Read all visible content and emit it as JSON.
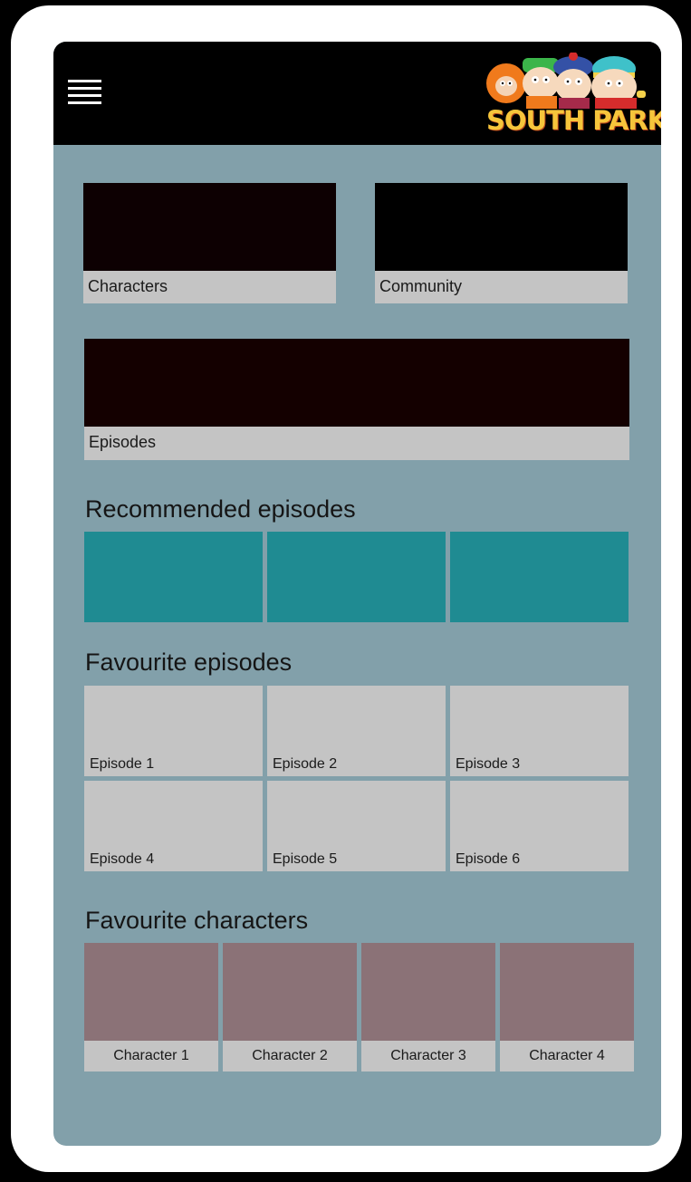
{
  "app": {
    "logo_text": "SOUTH PARK",
    "menu_icon": "hamburger-menu-icon"
  },
  "nav_tiles": {
    "characters": "Characters",
    "community": "Community",
    "episodes": "Episodes"
  },
  "sections": {
    "recommended_title": "Recommended episodes",
    "favourite_episodes_title": "Favourite episodes",
    "favourite_characters_title": "Favourite characters"
  },
  "favourite_episodes": [
    "Episode 1",
    "Episode 2",
    "Episode 3",
    "Episode 4",
    "Episode 5",
    "Episode 6"
  ],
  "favourite_characters": [
    "Character 1",
    "Character 2",
    "Character 3",
    "Character 4"
  ],
  "colors": {
    "background": "#82a0aa",
    "header": "#000000",
    "tile": "#c4c4c4",
    "recommended_card": "#1f8b92",
    "character_thumb": "#8b7277",
    "logo_text": "#f6c53b"
  }
}
